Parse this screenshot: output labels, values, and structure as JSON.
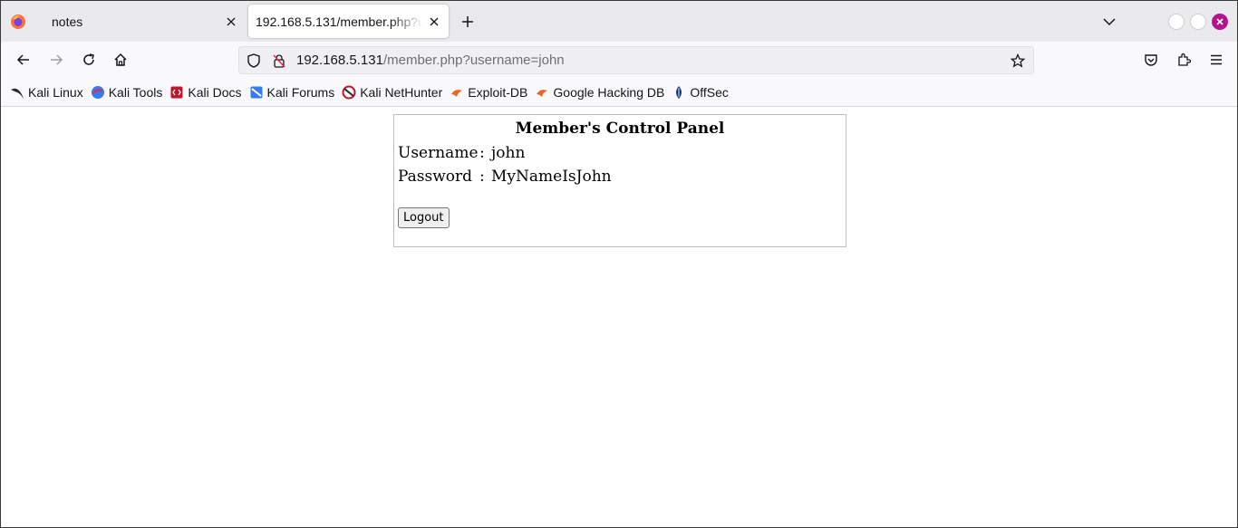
{
  "browser": {
    "tabs": [
      {
        "label": "notes",
        "active": false
      },
      {
        "label": "192.168.5.131/member.php?username=john",
        "active": true
      }
    ],
    "url": {
      "host": "192.168.5.131",
      "path": "/member.php?username=john"
    },
    "bookmarks": [
      {
        "label": "Kali Linux",
        "icon": "kali-dragon-icon"
      },
      {
        "label": "Kali Tools",
        "icon": "kali-tools-icon"
      },
      {
        "label": "Kali Docs",
        "icon": "kali-docs-icon"
      },
      {
        "label": "Kali Forums",
        "icon": "kali-forums-icon"
      },
      {
        "label": "Kali NetHunter",
        "icon": "kali-nethunter-icon"
      },
      {
        "label": "Exploit-DB",
        "icon": "exploit-db-icon"
      },
      {
        "label": "Google Hacking DB",
        "icon": "ghdb-icon"
      },
      {
        "label": "OffSec",
        "icon": "offsec-icon"
      }
    ],
    "colors": {
      "accent_close": "#b3128f",
      "tabstrip_bg": "#eaeaed",
      "toolbar_bg": "#f9f9fb"
    }
  },
  "page": {
    "panel_title": "Member's Control Panel",
    "fields": [
      {
        "label": "Username",
        "separator": ":",
        "value": "john"
      },
      {
        "label": "Password",
        "separator": ":",
        "value": "MyNameIsJohn"
      }
    ],
    "logout_label": "Logout"
  }
}
